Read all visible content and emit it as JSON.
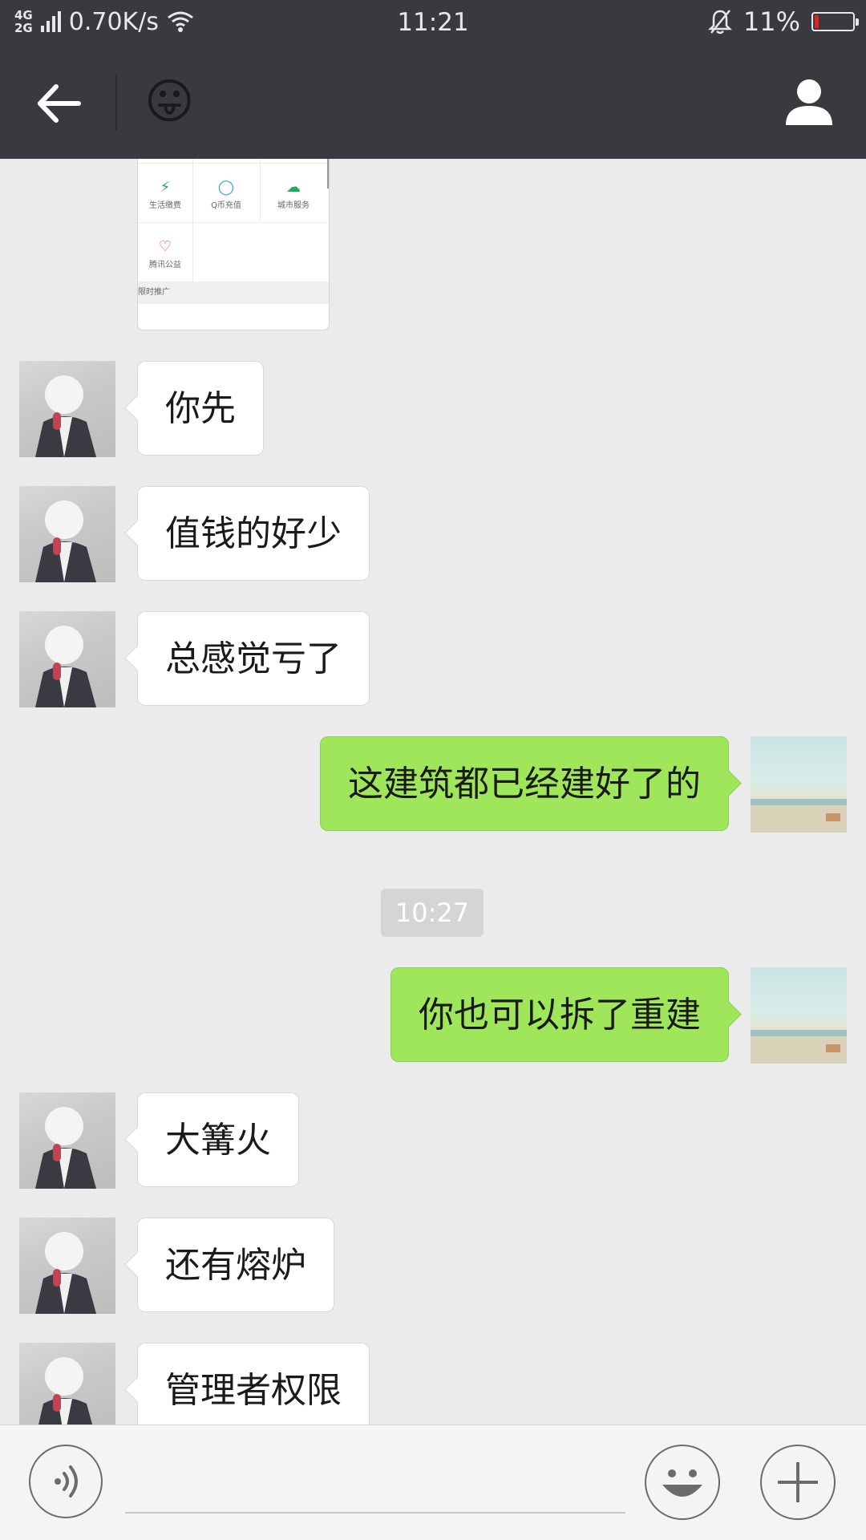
{
  "status_bar": {
    "network_top": "4G",
    "network_bottom": "2G",
    "speed": "0.70K/s",
    "time": "11:21",
    "battery": "11%",
    "battery_level": 0.11,
    "battery_color": "#e52222"
  },
  "header": {
    "chat_title_emoji": "😛",
    "back_icon": "arrow-left-icon",
    "profile_icon": "person-icon"
  },
  "shared_image": {
    "items": [
      {
        "icon": "⚡",
        "label": "生活缴费"
      },
      {
        "icon": "◯",
        "label": "Q币充值"
      },
      {
        "icon": "☁",
        "label": "城市服务"
      },
      {
        "icon": "♡",
        "label": "腾讯公益"
      }
    ],
    "promo_label": "限时推广"
  },
  "messages": [
    {
      "side": "recv",
      "text": "你先"
    },
    {
      "side": "recv",
      "text": "值钱的好少"
    },
    {
      "side": "recv",
      "text": "总感觉亏了"
    },
    {
      "side": "sent",
      "text": "这建筑都已经建好了的"
    },
    {
      "type": "time",
      "text": "10:27"
    },
    {
      "side": "sent",
      "text": "你也可以拆了重建"
    },
    {
      "side": "recv",
      "text": "大篝火"
    },
    {
      "side": "recv",
      "text": "还有熔炉"
    },
    {
      "side": "recv",
      "text": "管理者权限"
    }
  ],
  "input_bar": {
    "value": "",
    "voice_icon": "voice-icon",
    "emoji_icon": "smiley-icon",
    "plus_icon": "plus-icon"
  },
  "colors": {
    "bar_bg": "#393a3f",
    "chat_bg": "#ebebeb",
    "sent_bubble": "#9fe65b",
    "recv_bubble": "#ffffff"
  }
}
